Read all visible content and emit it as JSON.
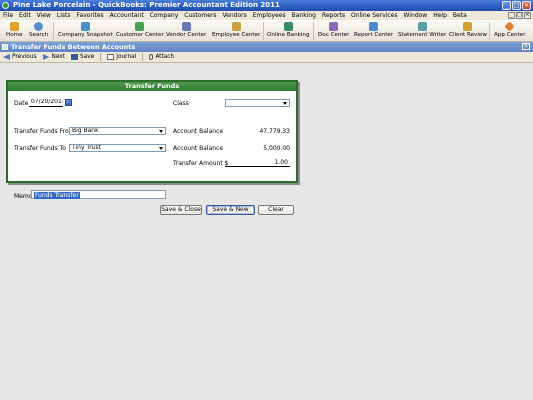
{
  "window": {
    "title": "Pine Lake Porcelain  - QuickBooks: Premier Accountant Edition 2011"
  },
  "menu": [
    "File",
    "Edit",
    "View",
    "Lists",
    "Favorites",
    "Accountant",
    "Company",
    "Customers",
    "Vendors",
    "Employees",
    "Banking",
    "Reports",
    "Online Services",
    "Window",
    "Help",
    "Beta"
  ],
  "iconbar": [
    {
      "label": "Home",
      "icon": "home-icon",
      "color": "#e0a030"
    },
    {
      "label": "Search",
      "icon": "search-icon",
      "color": "#5a8ad0"
    },
    {
      "label": "Company Snapshot",
      "icon": "snapshot-icon",
      "color": "#4a90c8"
    },
    {
      "label": "Customer Center",
      "icon": "customer-icon",
      "color": "#4aa050"
    },
    {
      "label": "Vendor Center",
      "icon": "vendor-icon",
      "color": "#6a7ab8"
    },
    {
      "label": "Employee Center",
      "icon": "employee-icon",
      "color": "#c8a040"
    },
    {
      "label": "Online Banking",
      "icon": "bank-icon",
      "color": "#3a8a6a"
    },
    {
      "label": "Doc Center",
      "icon": "doc-icon",
      "color": "#8a6ab8"
    },
    {
      "label": "Report Center",
      "icon": "report-icon",
      "color": "#4a8ad0"
    },
    {
      "label": "Statement Writer",
      "icon": "statement-icon",
      "color": "#5aa0a0"
    },
    {
      "label": "Client Review",
      "icon": "review-icon",
      "color": "#d0a030"
    },
    {
      "label": "App Center",
      "icon": "app-center-icon",
      "color": "#e08030"
    }
  ],
  "form": {
    "title": "Transfer Funds Between Accounts",
    "toolbar": {
      "previous": "Previous",
      "next": "Next",
      "save": "Save",
      "journal": "Journal",
      "attach": "Attach"
    },
    "panel_title": "Transfer Funds",
    "date_label": "Date",
    "date_value": "07/20/2011",
    "class_label": "Class",
    "class_value": "",
    "from_label": "Transfer Funds From",
    "from_value": "Big Bank",
    "from_balance_label": "Account Balance",
    "from_balance": "47,779.33",
    "to_label": "Transfer Funds To",
    "to_value": "Tiny Trust",
    "to_balance_label": "Account Balance",
    "to_balance": "5,000.00",
    "amount_label": "Transfer Amount $",
    "amount": "1.00",
    "memo_label": "Memo",
    "memo_value": "Funds Transfer",
    "buttons": {
      "save_close": "Save & Close",
      "save_new": "Save & New",
      "clear": "Clear"
    }
  },
  "colors": {
    "titlebar": "#2a5cc0",
    "panel_border": "#2a6e2a",
    "panel_header": "#3f8a3f",
    "selection": "#316ac5"
  }
}
